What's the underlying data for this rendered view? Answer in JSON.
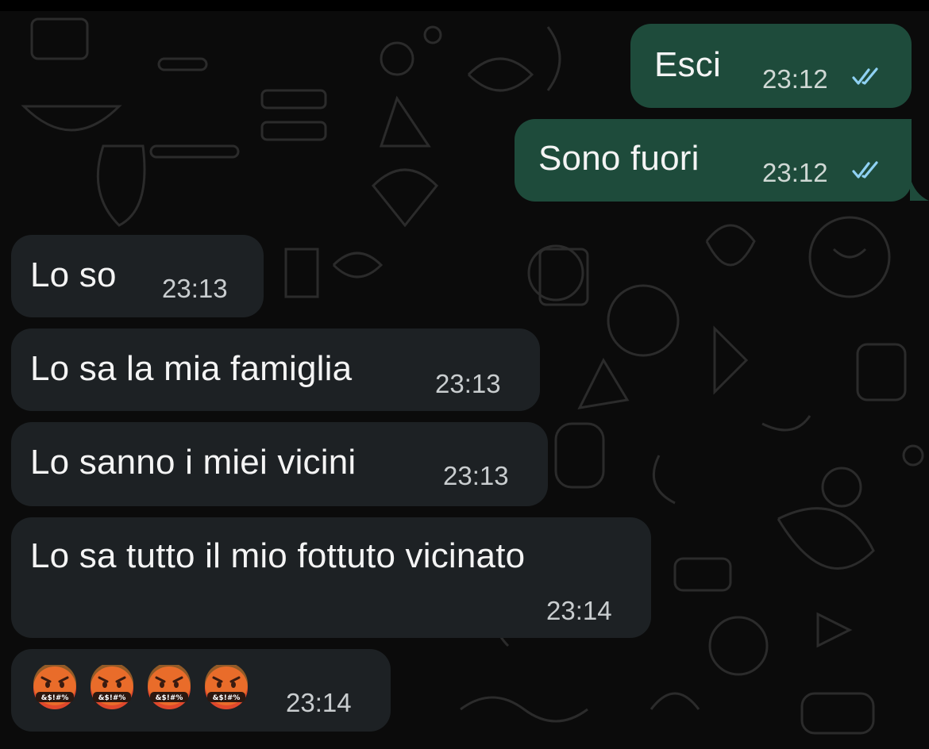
{
  "colors": {
    "outgoing_bubble": "#1e4b3b",
    "incoming_bubble": "#1d2124",
    "read_ticks": "#8fd1f3",
    "background": "#0b0b0b"
  },
  "messages": [
    {
      "direction": "outgoing",
      "text": "Esci",
      "time": "23:12",
      "status": "read-double-check-icon"
    },
    {
      "direction": "outgoing",
      "text": "Sono fuori",
      "time": "23:12",
      "status": "read-double-check-icon"
    },
    {
      "direction": "incoming",
      "text": "Lo so",
      "time": "23:13"
    },
    {
      "direction": "incoming",
      "text": "Lo sa la mia famiglia",
      "time": "23:13"
    },
    {
      "direction": "incoming",
      "text": "Lo sanno i miei vicini",
      "time": "23:13"
    },
    {
      "direction": "incoming",
      "text": "Lo sa tutto il mio fottuto vicinato",
      "time": "23:14"
    },
    {
      "direction": "incoming",
      "emoji": [
        "face-with-symbols-on-mouth-icon",
        "face-with-symbols-on-mouth-icon",
        "face-with-symbols-on-mouth-icon",
        "face-with-symbols-on-mouth-icon"
      ],
      "emoji_label": "&$!#%",
      "time": "23:14"
    }
  ]
}
